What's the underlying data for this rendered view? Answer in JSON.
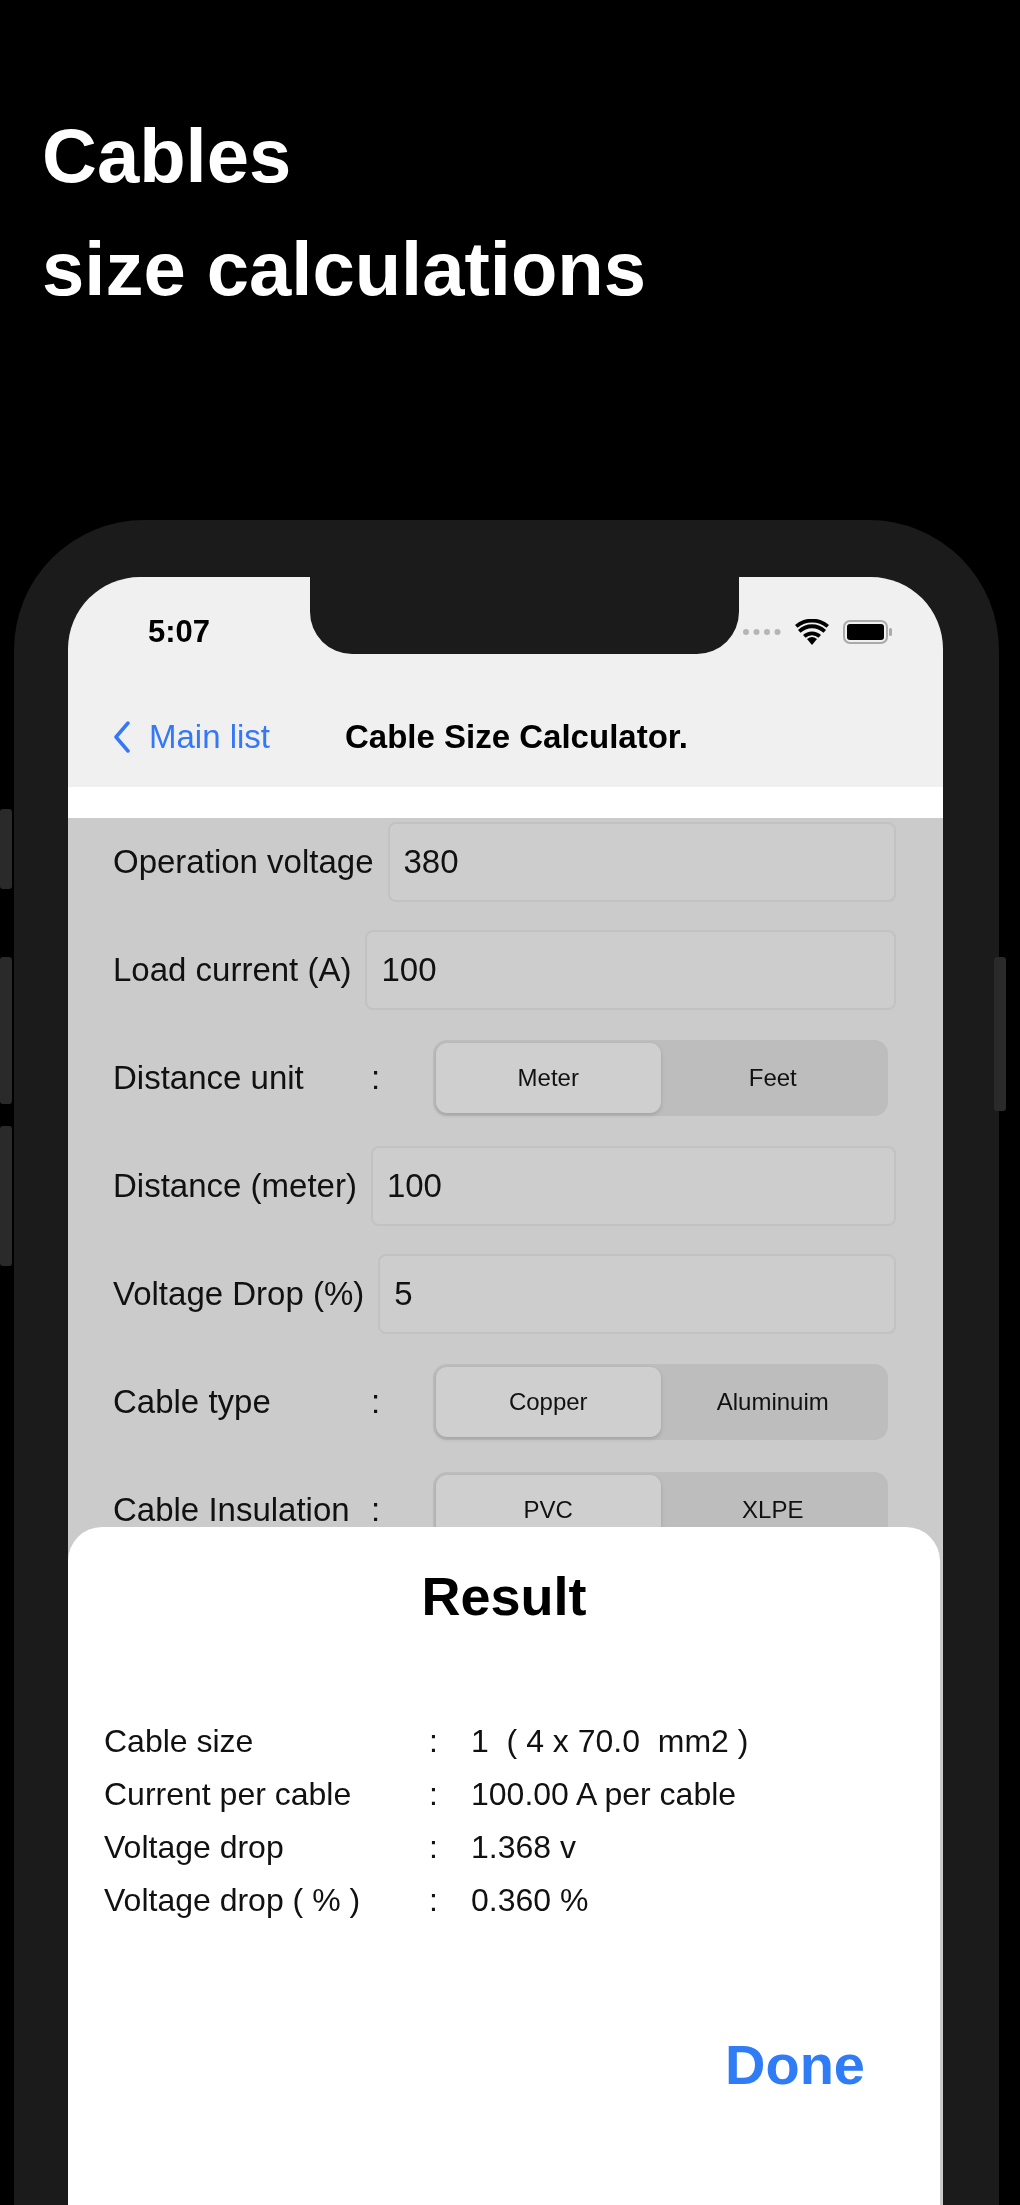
{
  "headline": [
    "Cables",
    "size calculations"
  ],
  "status_bar": {
    "time": "5:07"
  },
  "nav": {
    "back": "Main list",
    "title": "Cable Size Calculator."
  },
  "form": [
    {
      "kind": "field",
      "label": "Operation voltage",
      "value": "380"
    },
    {
      "kind": "field",
      "label": "Load current (A)",
      "value": "100"
    },
    {
      "kind": "segmented",
      "label": "Distance unit",
      "separator": ":",
      "options": [
        {
          "label": "Meter",
          "selected": true
        },
        {
          "label": "Feet",
          "selected": false
        }
      ]
    },
    {
      "kind": "field",
      "label": "Distance (meter)",
      "value": "100"
    },
    {
      "kind": "field",
      "label": "Voltage Drop (%)",
      "value": "5"
    },
    {
      "kind": "segmented",
      "label": "Cable type",
      "separator": ":",
      "options": [
        {
          "label": "Copper",
          "selected": true
        },
        {
          "label": "Aluminuim",
          "selected": false
        }
      ]
    },
    {
      "kind": "segmented",
      "label": "Cable Insulation",
      "separator": ":",
      "options": [
        {
          "label": "PVC",
          "selected": true
        },
        {
          "label": "XLPE",
          "selected": false
        }
      ]
    }
  ],
  "result": {
    "title": "Result",
    "lines": [
      {
        "label": "Cable size",
        "separator": ":",
        "value": "1  ( 4 x 70.0  mm2 )"
      },
      {
        "label": "Current per cable",
        "separator": ":",
        "value": "100.00 A per cable"
      },
      {
        "label": "Voltage drop",
        "separator": ":",
        "value": "1.368 v"
      },
      {
        "label": "Voltage drop ( % )",
        "separator": ":",
        "value": "0.360 %"
      }
    ],
    "button": "Done"
  }
}
